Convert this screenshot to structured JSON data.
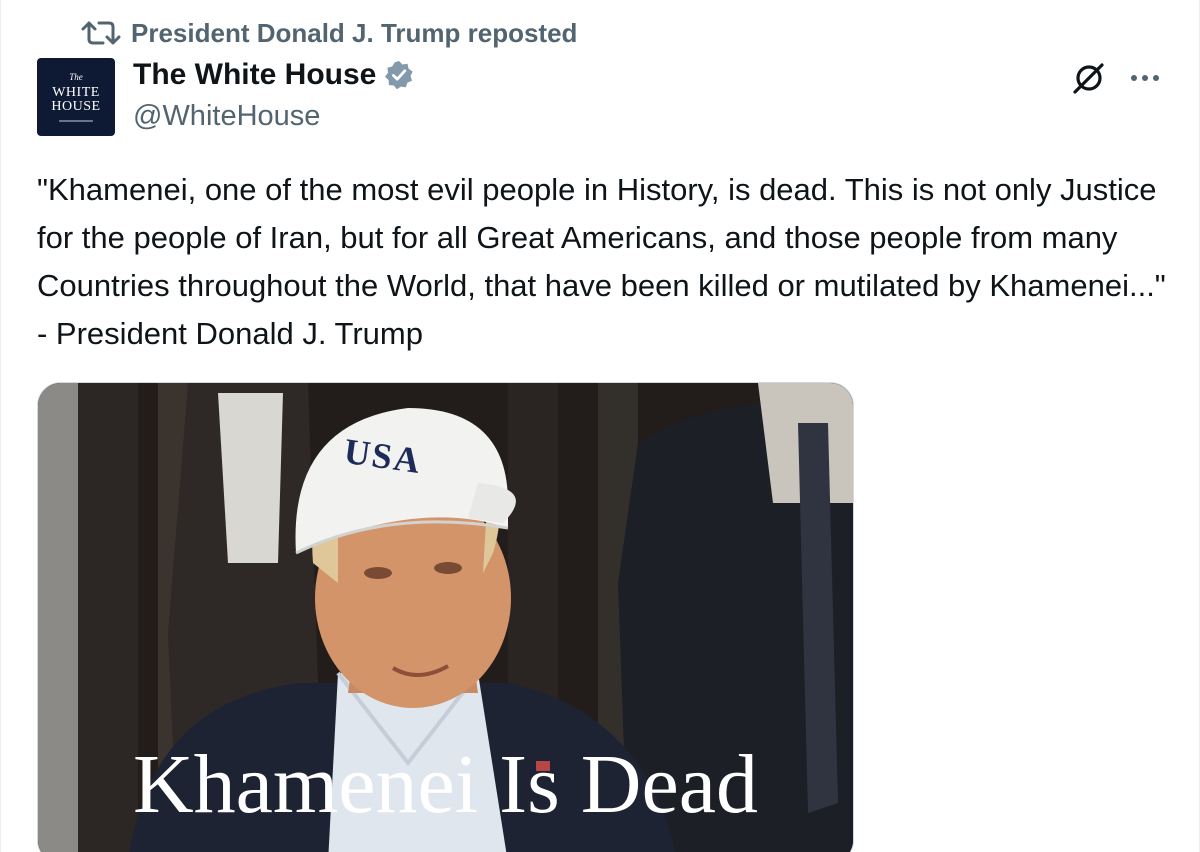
{
  "repost": {
    "icon": "repost-icon",
    "text": "President Donald J. Trump reposted"
  },
  "author": {
    "avatar_lines": [
      "The",
      "WHITE",
      "HOUSE"
    ],
    "display_name": "The White House",
    "verified_icon": "verified-badge-icon",
    "handle": "@WhiteHouse"
  },
  "actions": {
    "grok_icon": "grok-icon",
    "more_icon": "more-icon"
  },
  "tweet": {
    "text": "\"Khamenei, one of the most evil people in History, is dead. This is not only Justice for the people of Iran, but for all Great Americans, and those people from many Countries throughout the World, that have been killed or mutilated by Khamenei...\" - President Donald J. Trump"
  },
  "media": {
    "cap_text": "USA",
    "caption": "Khamenei Is Dead"
  },
  "colors": {
    "primary_text": "#0f1419",
    "secondary_text": "#536471",
    "verified": "#829aab",
    "avatar_bg": "#0e1a33"
  }
}
